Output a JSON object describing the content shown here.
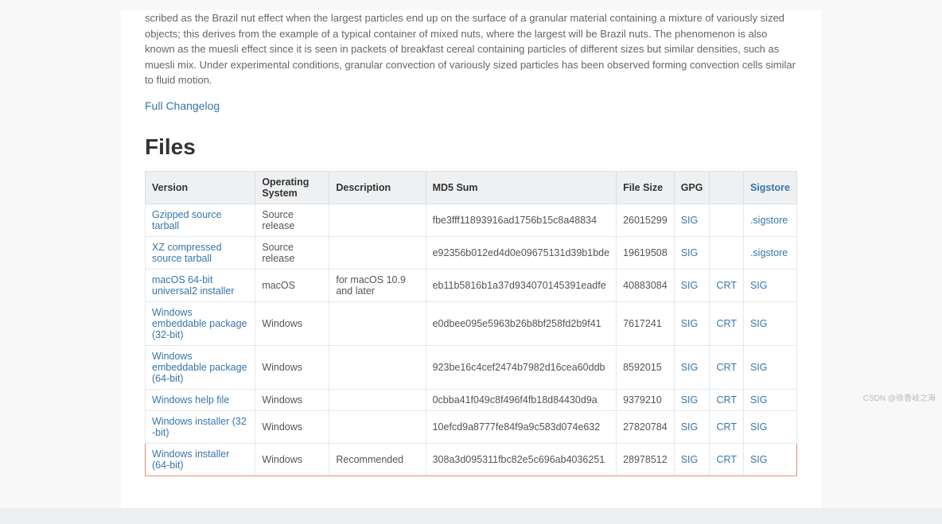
{
  "intro_text": "scribed as the Brazil nut effect when the largest particles end up on the surface of a granular material containing a mixture of variously sized objects; this derives from the example of a typical container of mixed nuts, where the largest will be Brazil nuts. The phenomenon is also known as the muesli effect since it is seen in packets of breakfast cereal containing particles of different sizes but similar densities, such as muesli mix. Under experimental conditions, granular convection of variously sized particles has been observed forming convection cells similar to fluid motion.",
  "changelog_link": "Full Changelog",
  "files_heading": "Files",
  "table": {
    "headers": [
      "Version",
      "Operating System",
      "Description",
      "MD5 Sum",
      "File Size",
      "GPG",
      "",
      "Sigstore"
    ],
    "rows": [
      {
        "version": "Gzipped source tarball",
        "os": "Source release",
        "desc": "",
        "md5": "fbe3fff11893916ad1756b15c8a48834",
        "size": "26015299",
        "gpg": "SIG",
        "crt": "",
        "sig": ".sigstore"
      },
      {
        "version": "XZ compressed source tarball",
        "os": "Source release",
        "desc": "",
        "md5": "e92356b012ed4d0e09675131d39b1bde",
        "size": "19619508",
        "gpg": "SIG",
        "crt": "",
        "sig": ".sigstore"
      },
      {
        "version": "macOS 64-bit universal2 installer",
        "os": "macOS",
        "desc": "for macOS 10.9 and later",
        "md5": "eb11b5816b1a37d934070145391eadfe",
        "size": "40883084",
        "gpg": "SIG",
        "crt": "CRT",
        "sig": "SIG"
      },
      {
        "version": "Windows embeddable package (32-bit)",
        "os": "Windows",
        "desc": "",
        "md5": "e0dbee095e5963b26b8bf258fd2b9f41",
        "size": "7617241",
        "gpg": "SIG",
        "crt": "CRT",
        "sig": "SIG"
      },
      {
        "version": "Windows embeddable package (64-bit)",
        "os": "Windows",
        "desc": "",
        "md5": "923be16c4cef2474b7982d16cea60ddb",
        "size": "8592015",
        "gpg": "SIG",
        "crt": "CRT",
        "sig": "SIG"
      },
      {
        "version": "Windows help file",
        "os": "Windows",
        "desc": "",
        "md5": "0cbba41f049c8f496f4fb18d84430d9a",
        "size": "9379210",
        "gpg": "SIG",
        "crt": "CRT",
        "sig": "SIG"
      },
      {
        "version": "Windows installer (32 -bit)",
        "os": "Windows",
        "desc": "",
        "md5": "10efcd9a8777fe84f9a9c583d074e632",
        "size": "27820784",
        "gpg": "SIG",
        "crt": "CRT",
        "sig": "SIG"
      },
      {
        "version": "Windows installer (64-bit)",
        "os": "Windows",
        "desc": "Recommended",
        "md5": "308a3d095311fbc82e5c696ab4036251",
        "size": "28978512",
        "gpg": "SIG",
        "crt": "CRT",
        "sig": "SIG",
        "highlight": true
      }
    ]
  },
  "watermark": "CSDN @徐香岐之海"
}
